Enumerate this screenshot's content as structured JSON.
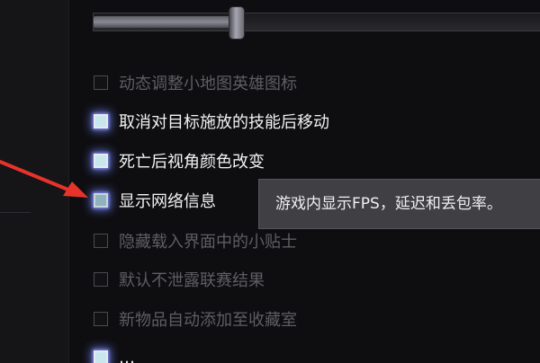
{
  "options": [
    {
      "label": "动态调整小地图英雄图标",
      "checked": false
    },
    {
      "label": "取消对目标施放的技能后移动",
      "checked": true
    },
    {
      "label": "死亡后视角颜色改变",
      "checked": true
    },
    {
      "label": "显示网络信息",
      "checked": true,
      "hovered": true
    },
    {
      "label": "隐藏载入界面中的小贴士",
      "checked": false
    },
    {
      "label": "默认不泄露联赛结果",
      "checked": false
    },
    {
      "label": "新物品自动添加至收藏室",
      "checked": false
    },
    {
      "label": "…",
      "checked": true
    }
  ],
  "tooltip": {
    "text": "游戏内显示FPS，延迟和丢包率。"
  },
  "slider": {
    "value_fraction": 0.33
  },
  "colors": {
    "checked_glow": "#6978e6",
    "checked_fill": "#c7e7ec",
    "unchecked_text": "#5e5e63",
    "checked_text": "#f2f2f2",
    "arrow": "#e8332a"
  },
  "icons": {
    "pointer": "red-arrow-icon"
  }
}
